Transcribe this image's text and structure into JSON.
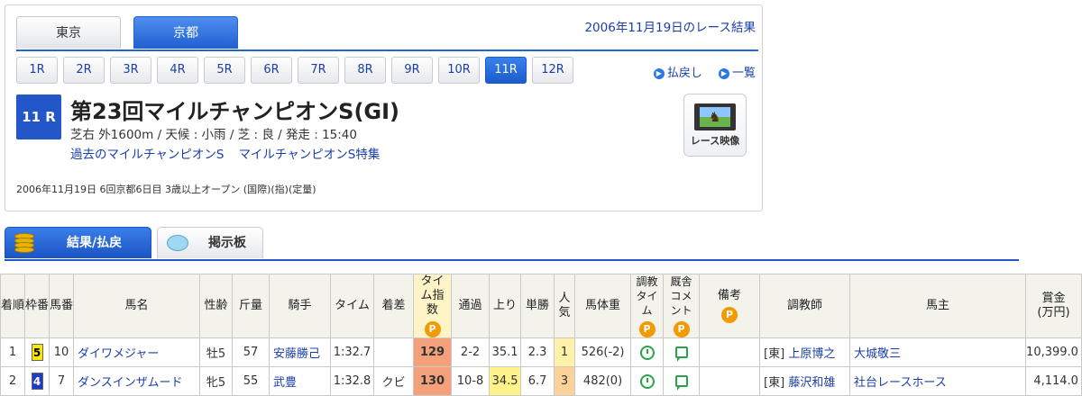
{
  "venue_tabs": [
    "東京",
    "京都"
  ],
  "race_date": "2006年11月19日のレース結果",
  "race_buttons": [
    "1R",
    "2R",
    "3R",
    "4R",
    "5R",
    "6R",
    "7R",
    "8R",
    "9R",
    "10R",
    "11R",
    "12R"
  ],
  "race_links": {
    "payout": "払戻し",
    "list": "一覧"
  },
  "race": {
    "number": "11 R",
    "title": "第23回マイルチャンピオンS(GI)",
    "conditions": "芝右 外1600m / 天候 : 小雨 / 芝 : 良 / 発走 : 15:40",
    "link_past": "過去のマイルチャンピオンS",
    "link_special": "マイルチャンピオンS特集",
    "info": "2006年11月19日 6回京都6日目 3歳以上オープン (国際)(指)(定量)"
  },
  "video_label": "レース映像",
  "result_tabs": {
    "results": "結果/払戻",
    "board": "掲示板"
  },
  "table": {
    "headers": {
      "rank": "着順",
      "frame": "枠番",
      "horse_no": "馬番",
      "horse_name": "馬名",
      "sex_age": "性齢",
      "weight": "斤量",
      "jockey": "騎手",
      "time": "タイム",
      "margin": "着差",
      "time_index": "タイム指数",
      "passing": "通過",
      "last3f": "上り",
      "odds": "単勝",
      "popularity": "人気",
      "body_weight": "馬体重",
      "training_time": "調教タイム",
      "stable_comment": "厩舎コメント",
      "remarks": "備考",
      "trainer": "調教師",
      "owner": "馬主",
      "prize": "賞金(万円)"
    },
    "p_icon": "P",
    "rows": [
      {
        "rank": "1",
        "frame": "5",
        "horse_no": "10",
        "horse_name": "ダイワメジャー",
        "sex_age": "牡5",
        "weight": "57",
        "jockey": "安藤勝己",
        "time": "1:32.7",
        "margin": "",
        "time_index": "129",
        "passing": "2-2",
        "last3f": "35.1",
        "odds": "2.3",
        "popularity": "1",
        "body_weight": "526(-2)",
        "trainer_region": "[東]",
        "trainer": "上原博之",
        "owner": "大城敬三",
        "prize": "10,399.0"
      },
      {
        "rank": "2",
        "frame": "4",
        "horse_no": "7",
        "horse_name": "ダンスインザムード",
        "sex_age": "牝5",
        "weight": "55",
        "jockey": "武豊",
        "time": "1:32.8",
        "margin": "クビ",
        "time_index": "130",
        "passing": "10-8",
        "last3f": "34.5",
        "odds": "6.7",
        "popularity": "3",
        "body_weight": "482(0)",
        "trainer_region": "[東]",
        "trainer": "藤沢和雄",
        "owner": "社台レースホース",
        "prize": "4,114.0"
      }
    ]
  },
  "colors": {
    "accent_blue": "#2356c9",
    "frame5": "#ffe600",
    "frame4": "#1e3cc8",
    "time_index_high": "#f4a07a",
    "p_icon": "#f29a00"
  }
}
